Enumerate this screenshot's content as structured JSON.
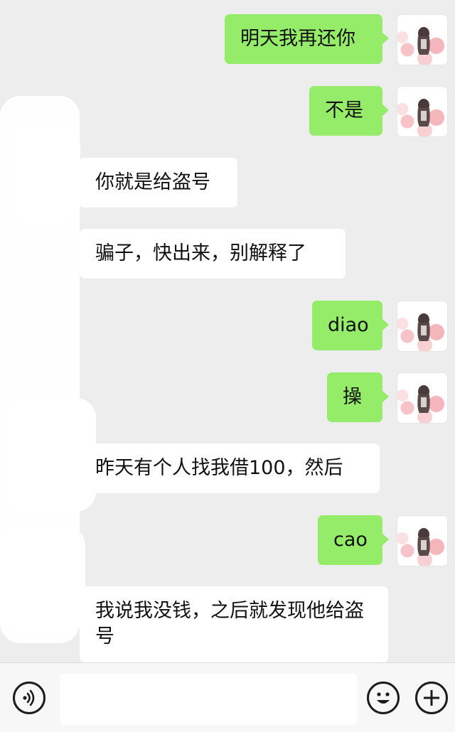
{
  "messages": [
    {
      "side": "me",
      "text": "明天我再还你"
    },
    {
      "side": "me",
      "text": "不是"
    },
    {
      "side": "other",
      "text": "你就是给盗号"
    },
    {
      "side": "other",
      "text": "骗子，快出来，别解释了"
    },
    {
      "side": "me",
      "text": "diao"
    },
    {
      "side": "me",
      "text": "操"
    },
    {
      "side": "other",
      "text": "昨天有个人找我借100，然后"
    },
    {
      "side": "me",
      "text": "cao"
    },
    {
      "side": "other",
      "text": "我说我没钱，之后就发现他给盗号"
    }
  ],
  "colors": {
    "background": "#ededed",
    "sent_bubble": "#95ec69",
    "received_bubble": "#ffffff",
    "input_bar": "#f7f7f7"
  },
  "input_bar": {
    "voice_icon": "voice-icon",
    "emoji_icon": "emoji-icon",
    "more_icon": "plus-icon",
    "text_value": ""
  }
}
